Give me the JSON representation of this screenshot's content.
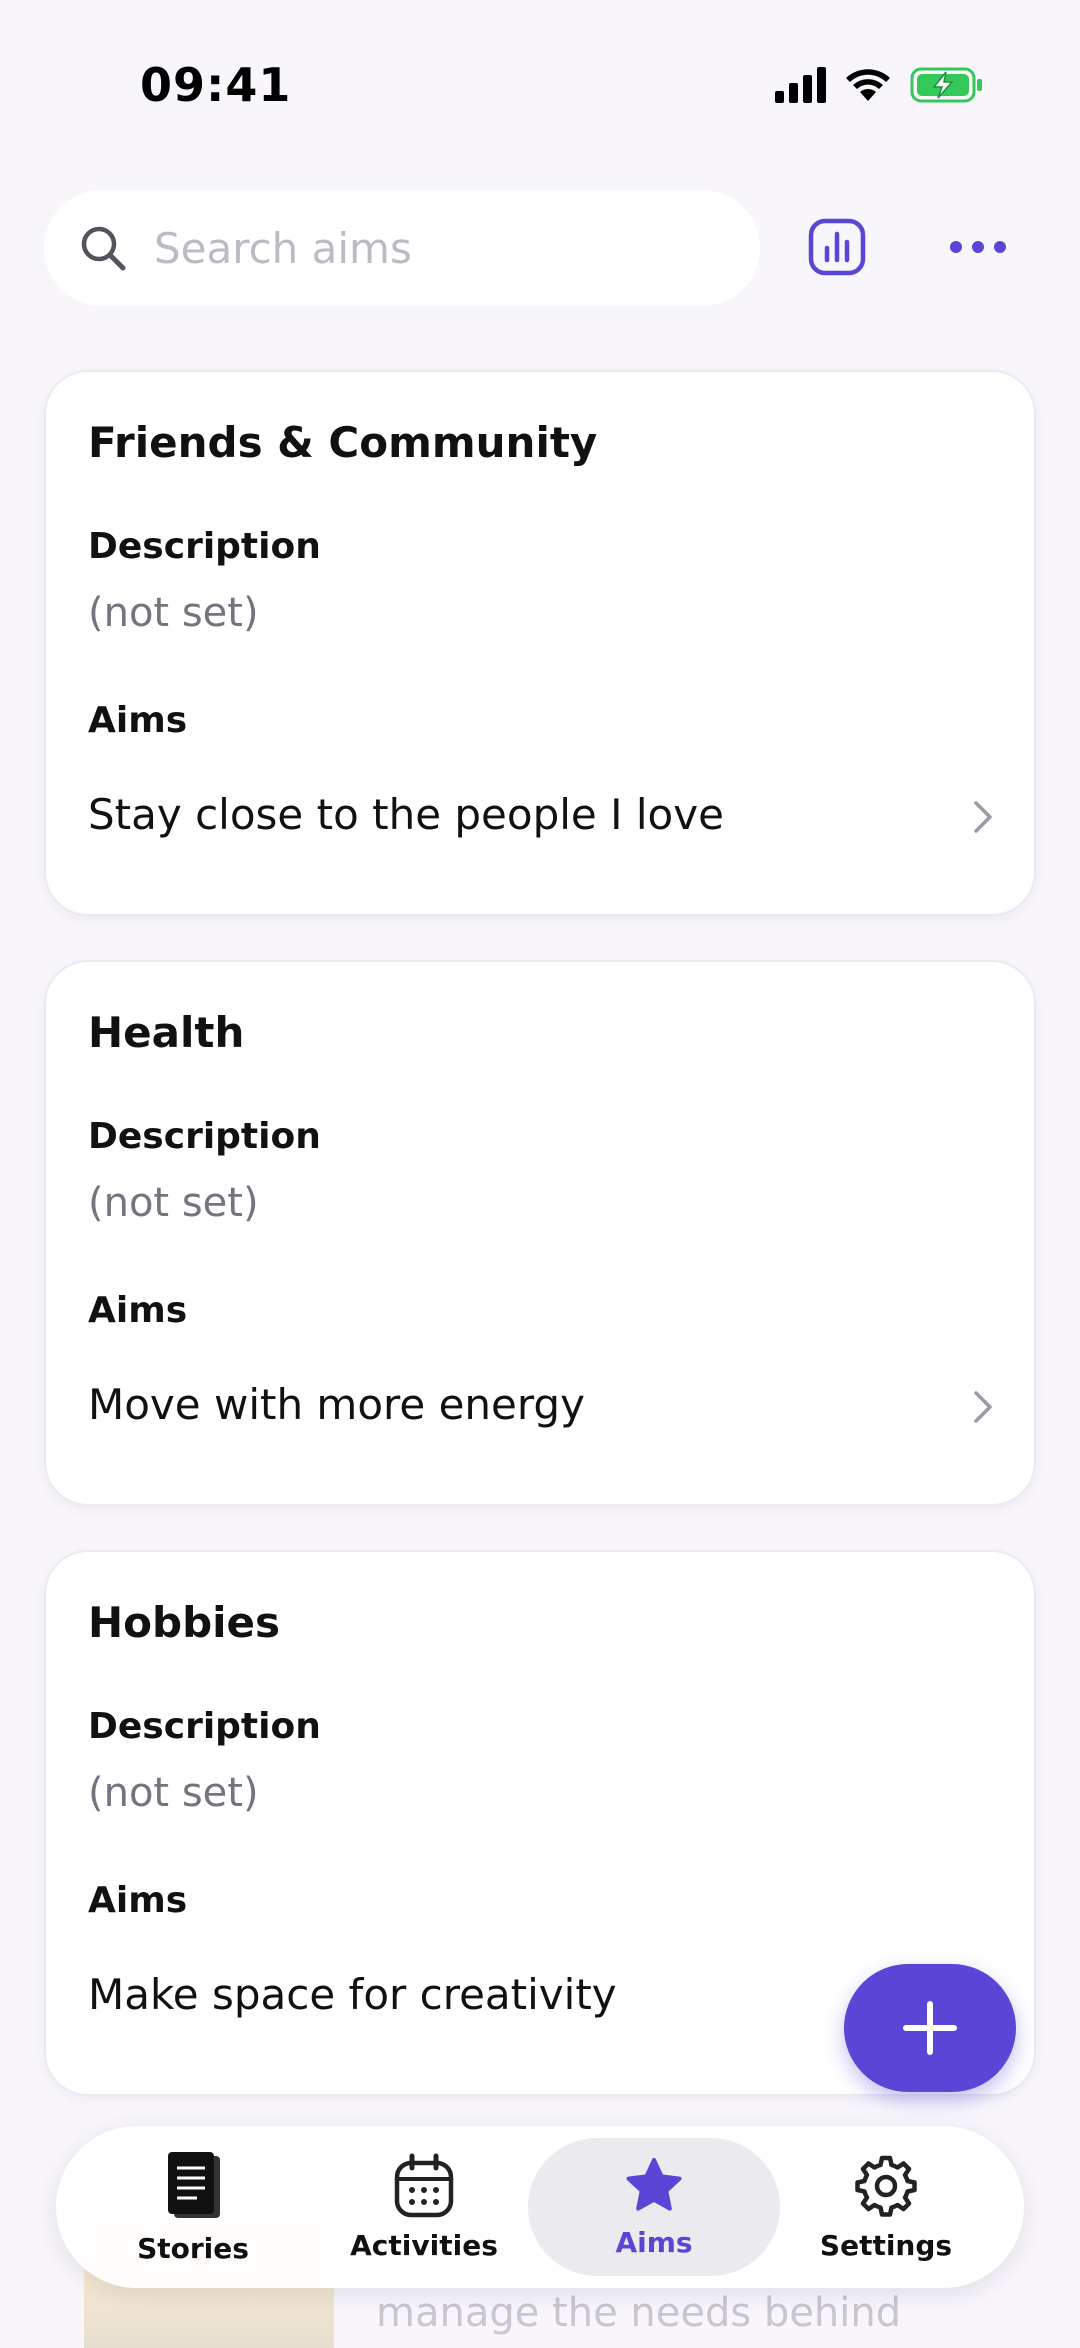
{
  "status_bar": {
    "time": "09:41"
  },
  "search": {
    "placeholder": "Search aims",
    "value": ""
  },
  "colors": {
    "accent": "#5a46d6",
    "battery": "#34c759",
    "background": "#f8f6fb"
  },
  "header_icons": {
    "stats": "bar-chart-icon",
    "more": "more-horizontal-icon"
  },
  "cards": [
    {
      "title": "Friends & Community",
      "description_label": "Description",
      "description": "(not set)",
      "aims_label": "Aims",
      "aims": [
        "Stay close to the people I love"
      ]
    },
    {
      "title": "Health",
      "description_label": "Description",
      "description": "(not set)",
      "aims_label": "Aims",
      "aims": [
        "Move with more energy"
      ]
    },
    {
      "title": "Hobbies",
      "description_label": "Description",
      "description": "(not set)",
      "aims_label": "Aims",
      "aims": [
        "Make space for creativity"
      ]
    }
  ],
  "background_peek": {
    "text": "manage the needs behind"
  },
  "fab": {
    "icon": "plus-icon"
  },
  "nav": {
    "items": [
      {
        "label": "Stories",
        "icon": "notebook-icon"
      },
      {
        "label": "Activities",
        "icon": "calendar-icon"
      },
      {
        "label": "Aims",
        "icon": "star-icon",
        "active": true
      },
      {
        "label": "Settings",
        "icon": "gear-icon"
      }
    ]
  }
}
